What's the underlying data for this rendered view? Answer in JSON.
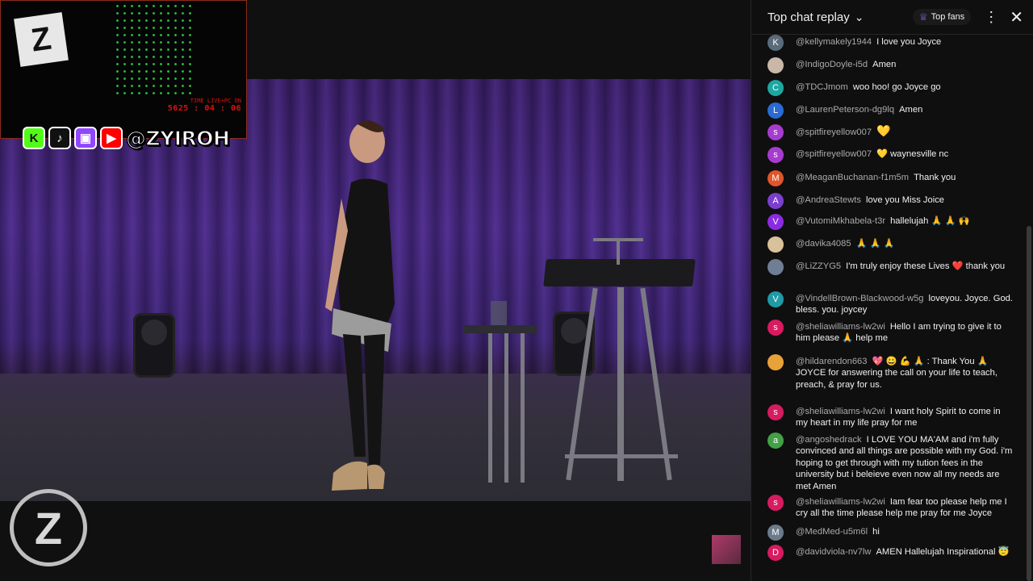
{
  "overlay": {
    "timer_label": "TIME LIVE+PC ON",
    "timer_value": "5625 : 04 : 06",
    "logo_letter": "Z",
    "handle": "@ZYIROH",
    "social": [
      {
        "icon": "kick-icon",
        "glyph": "K",
        "color": "#53fc18"
      },
      {
        "icon": "tiktok-icon",
        "glyph": "♪",
        "color": "#111111"
      },
      {
        "icon": "twitch-icon",
        "glyph": "▣",
        "color": "#9146ff"
      },
      {
        "icon": "youtube-icon",
        "glyph": "▶",
        "color": "#ff0000"
      }
    ]
  },
  "chat": {
    "title": "Top chat replay",
    "top_fans": "Top fans",
    "messages": [
      {
        "author": "@kellymakely1944",
        "initial": "K",
        "avatar_color": "#5a6b7a",
        "text": "I love you Joyce"
      },
      {
        "author": "@IndigoDoyle-i5d",
        "initial": "",
        "avatar_color": "#c9b8a8",
        "text": "Amen"
      },
      {
        "author": "@TDCJmom",
        "initial": "C",
        "avatar_color": "#1ea7a1",
        "text": "woo hoo! go Joyce go"
      },
      {
        "author": "@LaurenPeterson-dg9lq",
        "initial": "L",
        "avatar_color": "#2a6bd1",
        "text": "Amen"
      },
      {
        "author": "@spitfireyellow007",
        "initial": "s",
        "avatar_color": "#a63ccf",
        "text": "💛"
      },
      {
        "author": "@spitfireyellow007",
        "initial": "s",
        "avatar_color": "#a63ccf",
        "text": "💛 waynesville nc"
      },
      {
        "author": "@MeaganBuchanan-f1m5m",
        "initial": "M",
        "avatar_color": "#e0562a",
        "text": "Thank you"
      },
      {
        "author": "@AndreaStewts",
        "initial": "A",
        "avatar_color": "#7b3fcf",
        "text": "love you Miss Joice"
      },
      {
        "author": "@VutomiMkhabela-t3r",
        "initial": "V",
        "avatar_color": "#8a2be2",
        "text": "hallelujah 🙏 🙏 🙌"
      },
      {
        "author": "@davika4085",
        "initial": "",
        "avatar_color": "#d9c19a",
        "text": "🙏 🙏 🙏"
      },
      {
        "author": "@LiZZYG5",
        "initial": "",
        "avatar_color": "#6f7e95",
        "text": "I'm truly enjoy these Lives ❤️ thank you"
      },
      {
        "author": "@VindellBrown-Blackwood-w5g",
        "initial": "V",
        "avatar_color": "#1f9aa6",
        "text": "loveyou. Joyce. God. bless. you. joycey"
      },
      {
        "author": "@sheliawilliams-lw2wi",
        "initial": "s",
        "avatar_color": "#d81b60",
        "text": "Hello I am trying to give it to him please 🙏 help me"
      },
      {
        "author": "@hildarendon663",
        "initial": "",
        "avatar_color": "#e8a23a",
        "text": "💖 😀 💪 🙏 : Thank You 🙏 JOYCE for answering the call on your life to teach, preach, & pray for us."
      },
      {
        "author": "@sheliawilliams-lw2wi",
        "initial": "s",
        "avatar_color": "#d81b60",
        "text": "I want holy Spirit to come in my heart in my life pray for me"
      },
      {
        "author": "@angoshedrack",
        "initial": "a",
        "avatar_color": "#43a047",
        "text": "I LOVE YOU MA'AM and i'm fully convinced and all things are possible with my God. i'm hoping to get through with my tution fees in the university but i beleieve even now all my needs are met Amen"
      },
      {
        "author": "@sheliawilliams-lw2wi",
        "initial": "s",
        "avatar_color": "#d81b60",
        "text": "Iam fear too please help me I cry all the time please help me pray for me Joyce"
      },
      {
        "author": "@MedMed-u5m6l",
        "initial": "M",
        "avatar_color": "#6b7b8c",
        "text": "hi"
      },
      {
        "author": "@davidviola-nv7lw",
        "initial": "D",
        "avatar_color": "#d81b60",
        "text": "AMEN Hallelujah Inspirational 😇"
      }
    ]
  }
}
